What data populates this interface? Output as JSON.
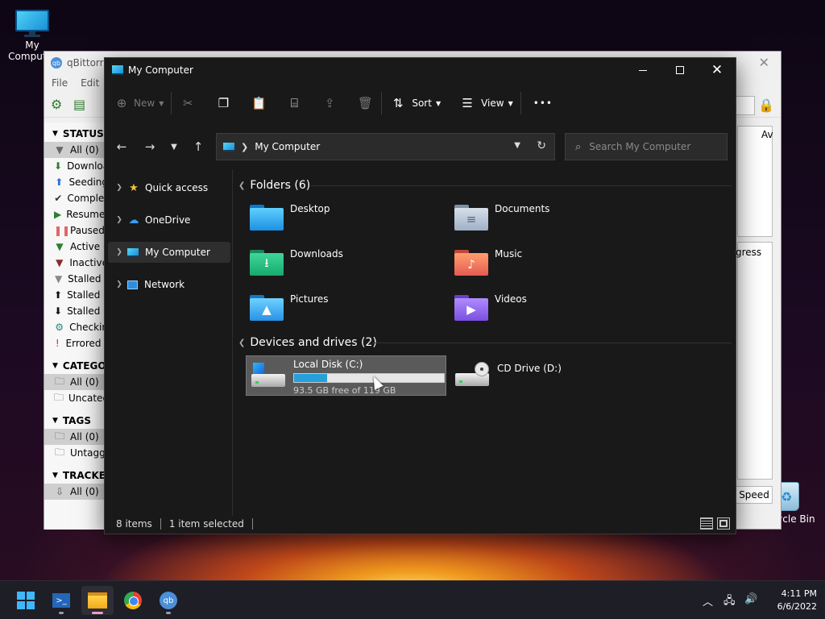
{
  "desktop": {
    "icons": [
      {
        "label": "My Computer"
      },
      {
        "label": "Recycle Bin"
      }
    ]
  },
  "qbittorrent": {
    "title": "qBittorre",
    "menu": [
      "File",
      "Edit"
    ],
    "sections": {
      "status": {
        "heading": "STATUS",
        "items": [
          "All (0)",
          "Downloa",
          "Seeding",
          "Complet",
          "Resumed",
          "Paused",
          "Active (",
          "Inactive",
          "Stalled (",
          "Stalled U",
          "Stalled D",
          "Checkin",
          "Errored ("
        ]
      },
      "categories": {
        "heading": "CATEGOR",
        "items": [
          "All (0)",
          "Uncateg"
        ]
      },
      "tags": {
        "heading": "TAGS",
        "items": [
          "All (0)",
          "Untagg"
        ]
      },
      "trackers": {
        "heading": "TRACKER",
        "items": [
          "All (0)"
        ]
      }
    },
    "panel_top_label": "Av",
    "progress_label": "gress",
    "speed_button": "Speed"
  },
  "explorer": {
    "title": "My Computer",
    "commands": {
      "new": "New",
      "sort": "Sort",
      "view": "View",
      "more": "•••"
    },
    "address": {
      "location": "My Computer"
    },
    "search": {
      "placeholder": "Search My Computer"
    },
    "nav": [
      {
        "label": "Quick access"
      },
      {
        "label": "OneDrive"
      },
      {
        "label": "My Computer"
      },
      {
        "label": "Network"
      }
    ],
    "groups": {
      "folders": {
        "title": "Folders (6)",
        "items": [
          {
            "name": "Desktop"
          },
          {
            "name": "Documents"
          },
          {
            "name": "Downloads"
          },
          {
            "name": "Music"
          },
          {
            "name": "Pictures"
          },
          {
            "name": "Videos"
          }
        ]
      },
      "drives": {
        "title": "Devices and drives (2)",
        "items": [
          {
            "name": "Local Disk (C:)",
            "free": "93.5 GB free of 119 GB",
            "used_fraction": 0.22
          },
          {
            "name": "CD Drive (D:)"
          }
        ]
      }
    },
    "status": {
      "items": "8 items",
      "selected": "1 item selected"
    }
  },
  "taskbar": {
    "clock": {
      "time": "4:11 PM",
      "date": "6/6/2022"
    },
    "apps": [
      "Start",
      "PowerShell",
      "File Explorer",
      "Google Chrome",
      "qBittorrent"
    ]
  },
  "colors": {
    "explorer_bg": "#191919",
    "selection": "#5a5a5a",
    "drive_bar": "#26a0da",
    "accent": "#3fb7ff"
  }
}
